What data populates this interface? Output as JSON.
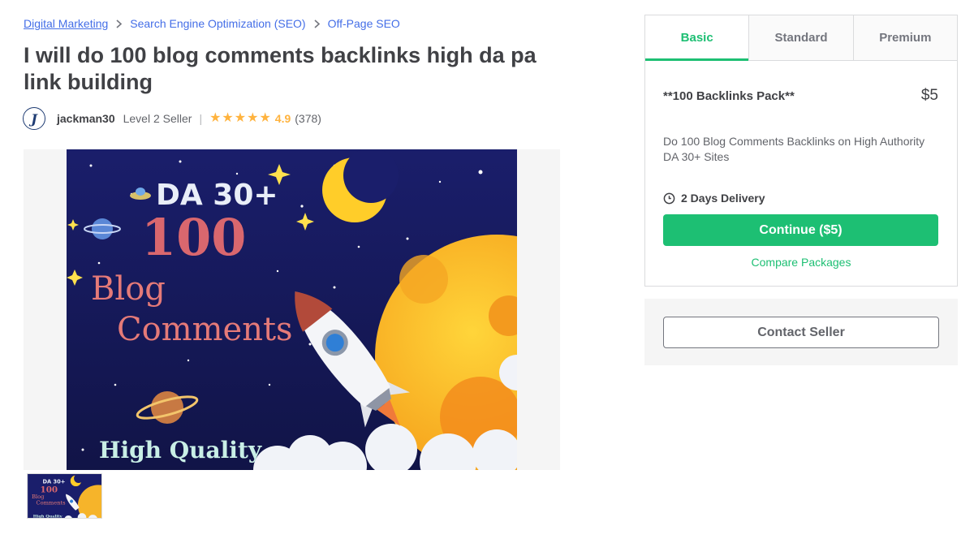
{
  "breadcrumb": [
    {
      "label": "Digital Marketing"
    },
    {
      "label": "Search Engine Optimization (SEO)"
    },
    {
      "label": "Off-Page SEO"
    }
  ],
  "gig": {
    "title": "I will do 100 blog comments backlinks high da pa link building"
  },
  "seller": {
    "avatar_letter": "J",
    "name": "jackman30",
    "level": "Level 2 Seller",
    "rating": "4.9",
    "rating_value": 4.9,
    "reviews": "(378)"
  },
  "gallery_image": {
    "line1": "DA 30+",
    "line2": "100",
    "line3": "Blog",
    "line4": "Comments",
    "line5": "High Quality"
  },
  "package": {
    "tabs": [
      {
        "label": "Basic",
        "active": true
      },
      {
        "label": "Standard",
        "active": false
      },
      {
        "label": "Premium",
        "active": false
      }
    ],
    "name": "**100 Backlinks Pack**",
    "price": "$5",
    "description": "Do 100 Blog Comments Backlinks on High Authority DA 30+ Sites",
    "delivery": "2 Days Delivery",
    "continue_label": "Continue ($5)",
    "compare_label": "Compare Packages"
  },
  "contact": {
    "label": "Contact Seller"
  },
  "colors": {
    "accent": "#1dbf73",
    "link": "#446ee7",
    "star": "#ffb33e"
  }
}
